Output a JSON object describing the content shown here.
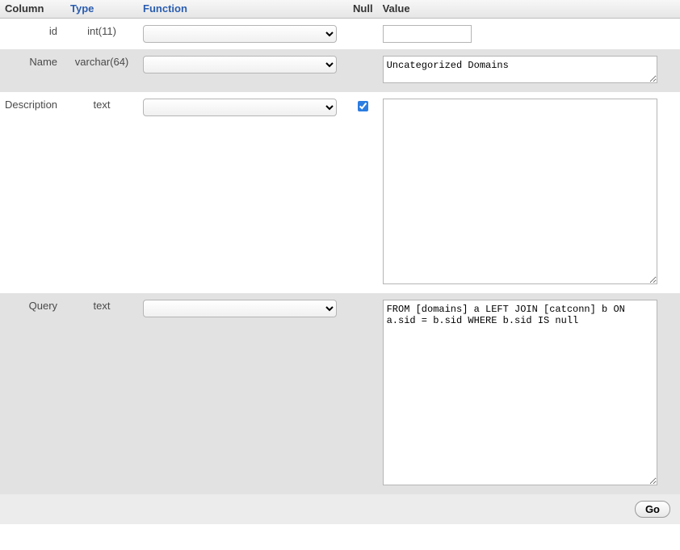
{
  "header": {
    "column": "Column",
    "type": "Type",
    "function": "Function",
    "null": "Null",
    "value": "Value"
  },
  "rows": [
    {
      "column": "id",
      "type": "int(11)",
      "function": "",
      "null_checked": false,
      "null_shown": false,
      "kind": "text",
      "value": ""
    },
    {
      "column": "Name",
      "type": "varchar(64)",
      "function": "",
      "null_checked": false,
      "null_shown": false,
      "kind": "textarea-small",
      "value": "Uncategorized Domains"
    },
    {
      "column": "Description",
      "type": "text",
      "function": "",
      "null_checked": true,
      "null_shown": true,
      "kind": "textarea-large",
      "value": ""
    },
    {
      "column": "Query",
      "type": "text",
      "function": "",
      "null_checked": false,
      "null_shown": false,
      "kind": "textarea-large",
      "value": "FROM [domains] a LEFT JOIN [catconn] b ON a.sid = b.sid WHERE b.sid IS null"
    }
  ],
  "footer": {
    "go": "Go"
  }
}
